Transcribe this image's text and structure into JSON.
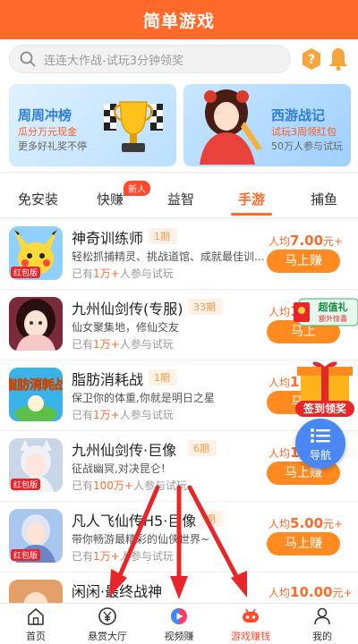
{
  "header": {
    "title": "简单游戏"
  },
  "search": {
    "placeholder": "连连大作战-试玩3分钟领奖"
  },
  "banners": [
    {
      "title": "周周冲榜",
      "sub1": "瓜分万元现金",
      "sub2": "更多好礼奖不停"
    },
    {
      "title": "西游战记",
      "sub1": "试玩3周领红包",
      "sub2": "50万人参与试玩"
    }
  ],
  "tabs": [
    {
      "label": "免安装"
    },
    {
      "label": "快赚",
      "badge": "新人"
    },
    {
      "label": "益智"
    },
    {
      "label": "手游"
    },
    {
      "label": "捕鱼"
    }
  ],
  "games": [
    {
      "name": "神奇训练师",
      "phase": "1期",
      "desc": "轻松抓捕精灵、挑战道馆、成就最佳训...",
      "count_pre": "已有",
      "count": "1万+",
      "count_post": "人参与试玩",
      "avg_pre": "人均",
      "avg": "7.00",
      "avg_post": "元+",
      "button": "马上赚",
      "tag": "红包版"
    },
    {
      "name": "九州仙剑传(专服)",
      "phase": "33期",
      "desc": "仙女聚集地，修仙交友",
      "count_pre": "已有",
      "count": "1万+",
      "count_post": "人参与试玩",
      "avg_pre": "人均",
      "avg": "10",
      "avg_post": "",
      "button": "马上",
      "tag": ""
    },
    {
      "name": "脂肪消耗战",
      "phase": "1期",
      "desc": "保卫你的体重,你就是明日之星",
      "count_pre": "已有",
      "count": "1万+",
      "count_post": "人参与试玩",
      "avg_pre": "人均",
      "avg": "1",
      "avg_post": "",
      "button": "马上",
      "tag": "",
      "thumb_text": "脂肪消耗战"
    },
    {
      "name": "九州仙剑传·巨像",
      "phase": "6期",
      "desc": "征战幽冥,对决昆仑!",
      "count_pre": "已有",
      "count": "100万+",
      "count_post": "人参与试玩",
      "avg_pre": "人均",
      "avg": "1",
      "avg_post": "",
      "button": "马上赚",
      "tag": "红包版"
    },
    {
      "name": "凡人飞仙传H5·巨像",
      "phase": "期",
      "desc": "带你畅游最精彩的仙侠世界~",
      "count_pre": "已有",
      "count": "1万+",
      "count_post": "人参与试玩",
      "avg_pre": "人均",
      "avg": "5.00",
      "avg_post": "元+",
      "button": "马上赚",
      "tag": "红包版"
    },
    {
      "name": "闲闲·最终战神",
      "phase": "",
      "desc": "",
      "count_pre": "",
      "count": "",
      "count_post": "",
      "avg_pre": "人均",
      "avg": "10.00",
      "avg_post": "元+",
      "button": "",
      "tag": ""
    }
  ],
  "floats": {
    "gift_text": "超值礼",
    "gift_sub": "额外惊喜",
    "sign_text": "签到领奖",
    "nav_label": "导航"
  },
  "bottom_nav": [
    {
      "label": "首页"
    },
    {
      "label": "悬赏大厅"
    },
    {
      "label": "视频赚"
    },
    {
      "label": "游戏赚钱"
    },
    {
      "label": "我的"
    }
  ],
  "colors": {
    "brand": "#ff6a2a",
    "button": "#ff8a1f",
    "annotation": "#e8262a"
  }
}
